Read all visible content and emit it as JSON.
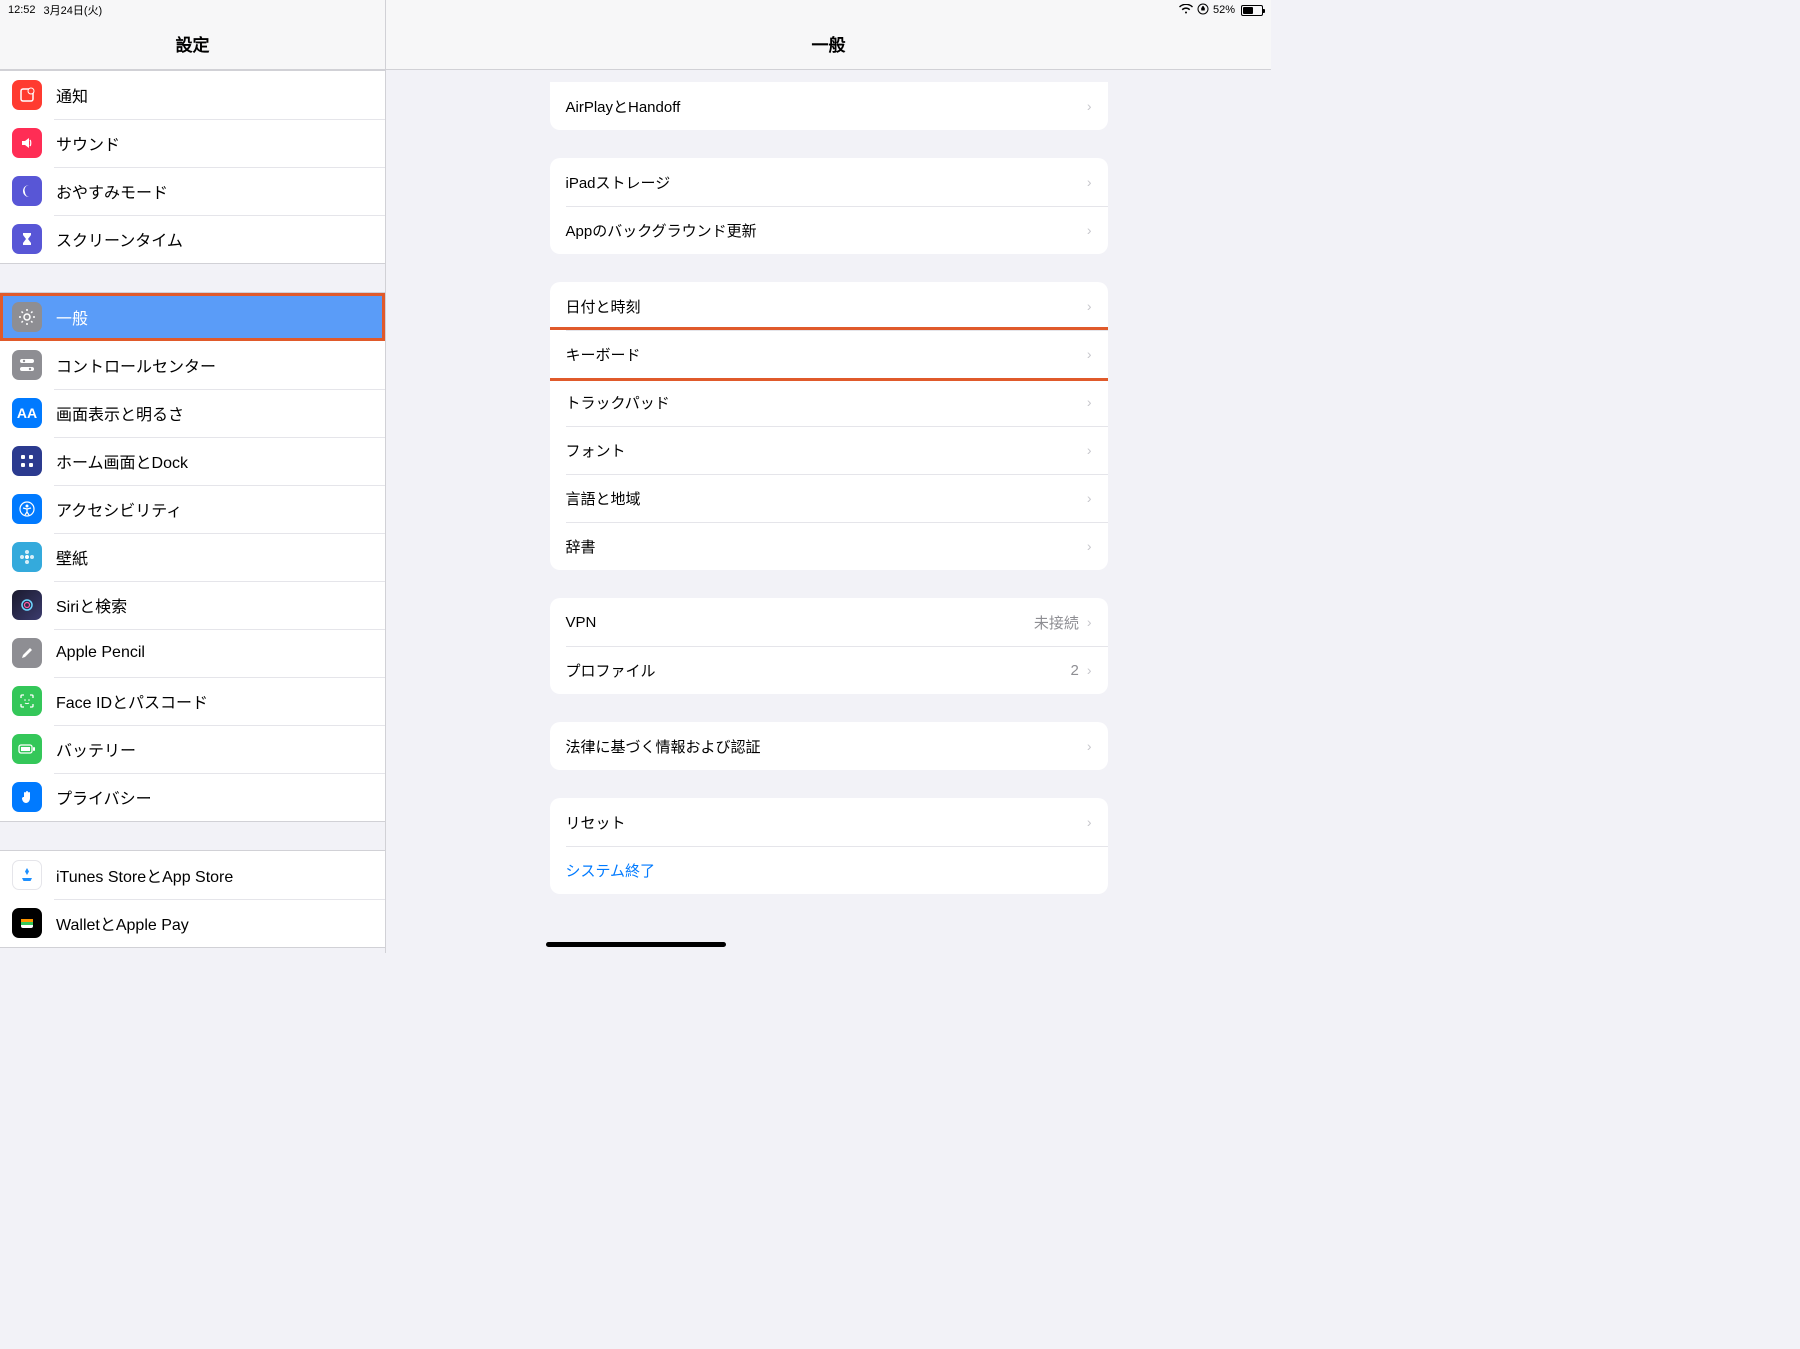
{
  "status": {
    "time": "12:52",
    "date": "3月24日(火)",
    "battery_pct": "52%"
  },
  "sidebar": {
    "title": "設定",
    "groups": {
      "g0": {
        "notifications": "通知",
        "sound": "サウンド",
        "dnd": "おやすみモード",
        "screentime": "スクリーンタイム"
      },
      "g1": {
        "general": "一般",
        "control": "コントロールセンター",
        "display": "画面表示と明るさ",
        "home": "ホーム画面とDock",
        "accessibility": "アクセシビリティ",
        "wallpaper": "壁紙",
        "siri": "Siriと検索",
        "pencil": "Apple Pencil",
        "faceid": "Face IDとパスコード",
        "battery": "バッテリー",
        "privacy": "プライバシー"
      },
      "g2": {
        "itunes": "iTunes StoreとApp Store",
        "wallet": "WalletとApple Pay"
      }
    }
  },
  "detail": {
    "title": "一般",
    "groups": {
      "g0": {
        "airplay": "AirPlayとHandoff"
      },
      "g1": {
        "storage": "iPadストレージ",
        "bgrefresh": "Appのバックグラウンド更新"
      },
      "g2": {
        "datetime": "日付と時刻",
        "keyboard": "キーボード",
        "trackpad": "トラックパッド",
        "fonts": "フォント",
        "language": "言語と地域",
        "dictionary": "辞書"
      },
      "g3": {
        "vpn": "VPN",
        "vpn_status": "未接続",
        "profile": "プロファイル",
        "profile_count": "2"
      },
      "g4": {
        "legal": "法律に基づく情報および認証"
      },
      "g5": {
        "reset": "リセット",
        "shutdown": "システム終了"
      }
    }
  }
}
